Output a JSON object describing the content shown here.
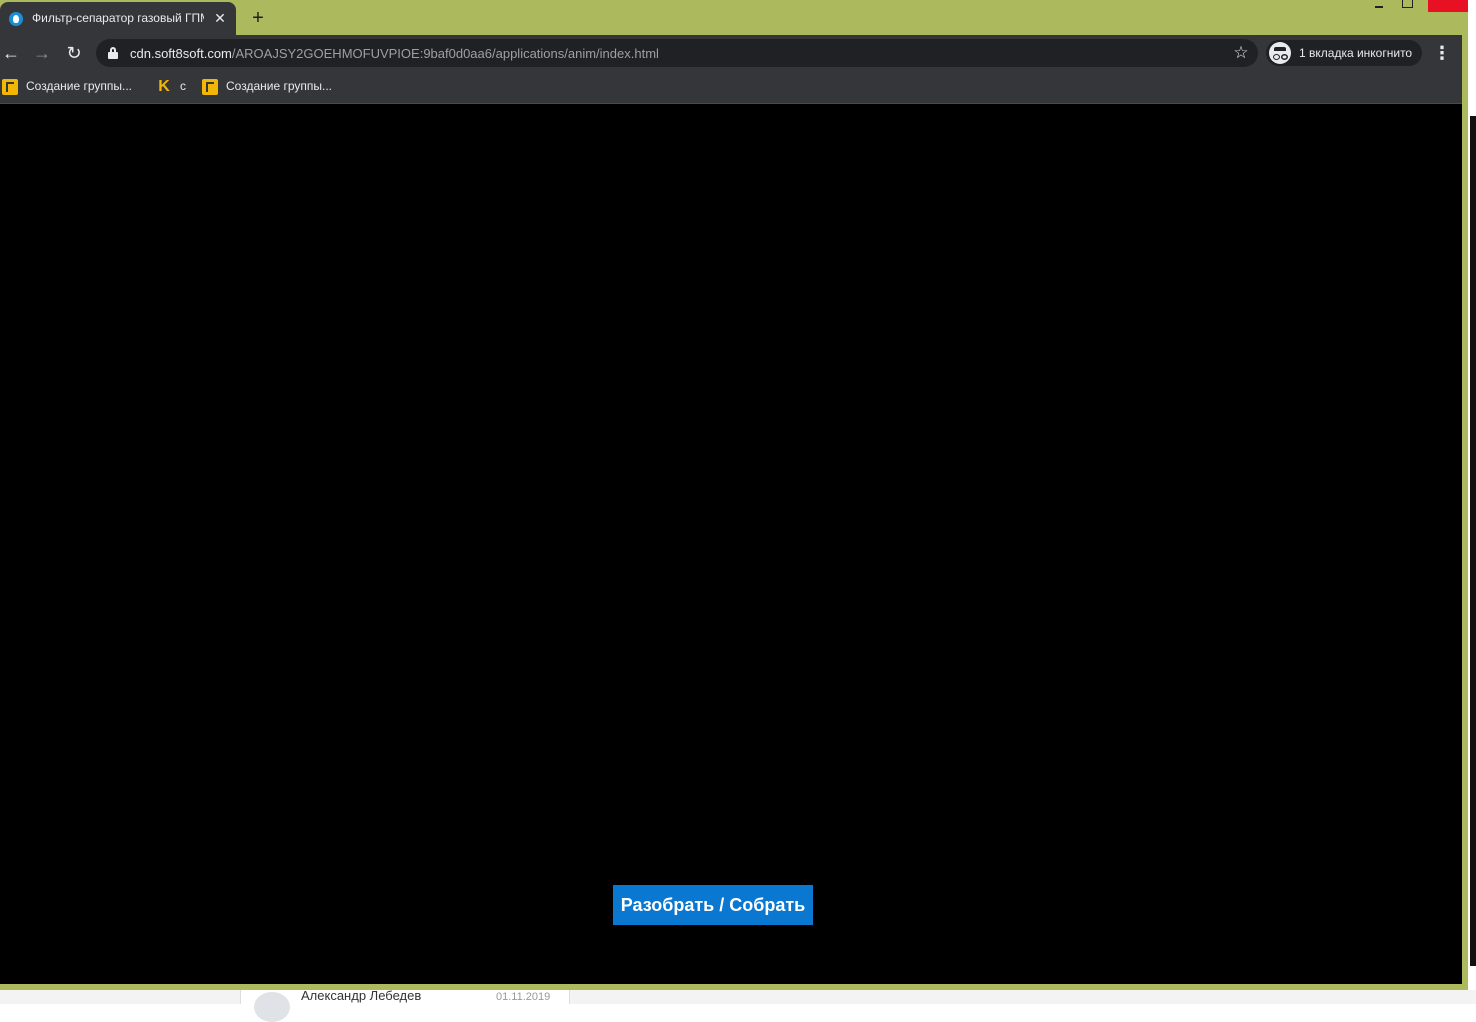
{
  "browser": {
    "tab_title": "Фильтр-сепаратор газовый ГПМ",
    "tab_close_glyph": "✕",
    "new_tab_glyph": "+",
    "url_host": "cdn.soft8soft.com",
    "url_path": "/AROAJSY2GOEHMOFUVPIOE:9baf0d0aa6/applications/anim/index.html",
    "incognito_label": "1 вкладка инкогнито",
    "back_glyph": "←",
    "forward_glyph": "→",
    "reload_glyph": "↻",
    "star_glyph": "☆",
    "menu_glyph": "⋮",
    "frame_color": "#acb95d"
  },
  "bookmarks": [
    {
      "label": "Создание группы...",
      "icon": "yellow-bookmark-icon"
    },
    {
      "label": "с",
      "icon": "k-logo-icon",
      "glyph": "K"
    },
    {
      "label": "Создание группы...",
      "icon": "yellow-bookmark-icon"
    }
  ],
  "app": {
    "background": "#000000",
    "action_button_label": "Разобрать / Собрать",
    "action_button_color": "#0a77d1"
  },
  "underlay": {
    "name": "Александр Лебедев",
    "date": "01.11.2019"
  }
}
